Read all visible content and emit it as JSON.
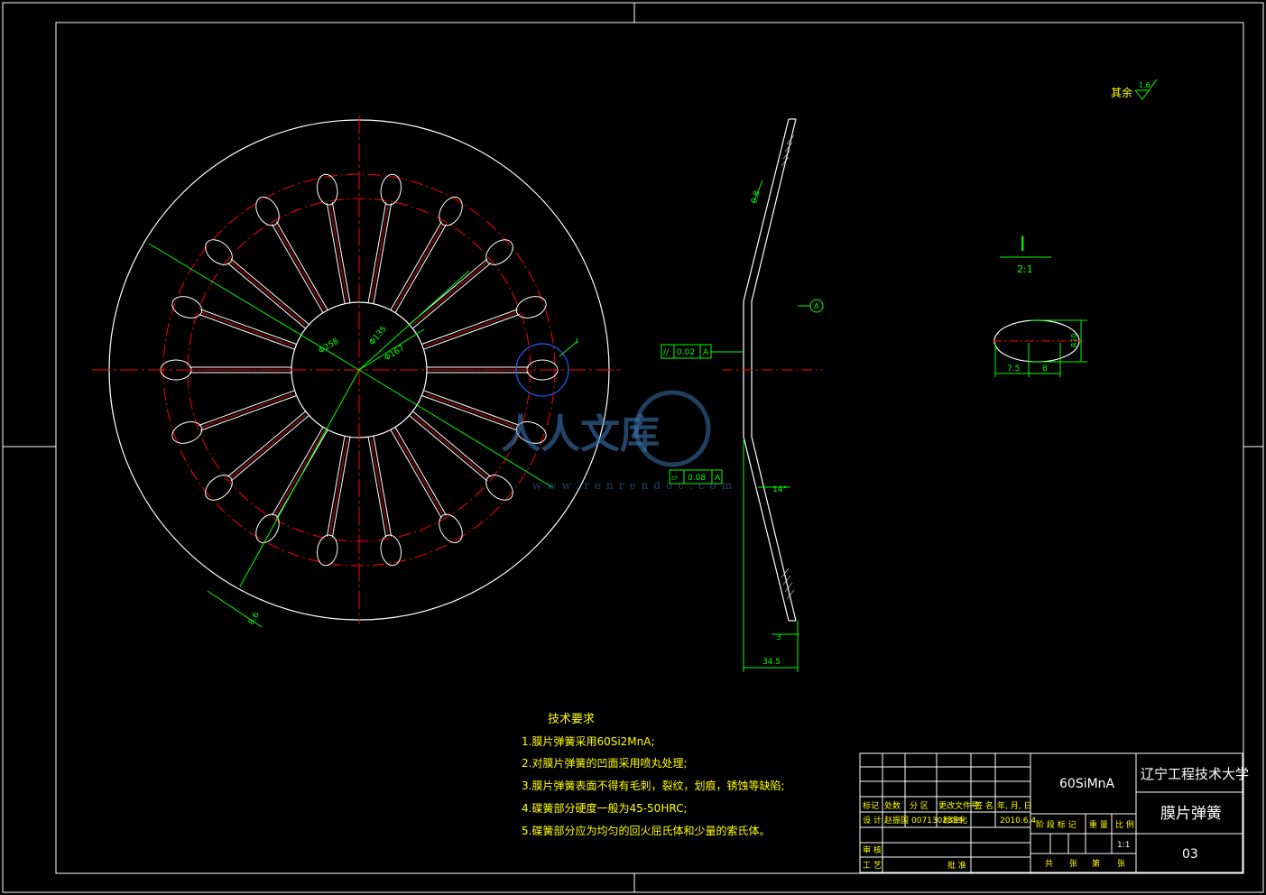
{
  "surface_roughness": {
    "label": "其余",
    "value": "1.6"
  },
  "detail_view": {
    "label": "I",
    "scale": "2:1",
    "dim_height": "R10",
    "dim_left": "7.5",
    "dim_right": "8"
  },
  "main_view": {
    "marker": "I",
    "dims": [
      "Φ258",
      "Φ135",
      "Φ167",
      "8.6"
    ]
  },
  "side_view": {
    "datum": "A",
    "tol_parallel": {
      "symbol": "//",
      "value": "0.02",
      "datum": "A"
    },
    "tol_flatness": {
      "symbol": "▱",
      "value": "0.08",
      "datum": "A"
    },
    "dim_thickness_top": "0.8",
    "dim_angle": "14°",
    "dim_thickness_bottom": "3",
    "dim_height": "34.5"
  },
  "tech_requirements": {
    "title": "技术要求",
    "items": [
      "1.膜片弹簧采用60Si2MnA;",
      "2.对膜片弹簧的凹面采用喷丸处理;",
      "3.膜片弹簧表面不得有毛刺，裂纹，划痕，锈蚀等缺陷;",
      "4.碟簧部分硬度一般为45-50HRC;",
      "5.碟簧部分应为均匀的回火屈氏体和少量的索氏体。"
    ]
  },
  "title_block": {
    "material": "60SiMnA",
    "school": "辽宁工程技术大学",
    "part_name": "膜片弹簧",
    "drawing_no": "03",
    "scale": "1:1",
    "revision_headers": [
      "标记",
      "处数",
      "分 区",
      "更改文件号",
      "签 名",
      "年, 月, 日"
    ],
    "design_row": [
      "设 计",
      "赵振国",
      "0071302339",
      "标准化",
      "",
      "2010.6.4"
    ],
    "stage_headers": [
      "阶 段 标 记",
      "重 量",
      "比 例"
    ],
    "review_label": "审 核",
    "process_label": "工 艺",
    "approve_label": "批 准",
    "sheet_row": [
      "共",
      "张",
      "第",
      "张"
    ]
  },
  "watermark": {
    "text": "人人文库",
    "url": "www.renrendoc.com"
  },
  "colors": {
    "outline": "#ffffff",
    "centerline": "#ff0000",
    "dimension": "#00ff00",
    "text": "#ffff00",
    "highlight": "#2060ff"
  }
}
